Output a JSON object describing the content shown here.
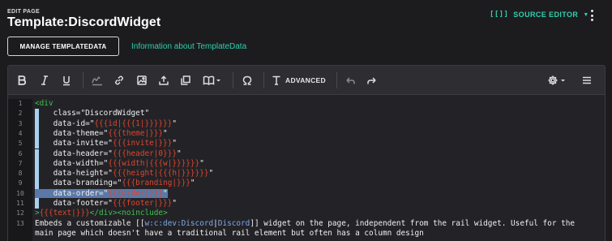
{
  "header": {
    "edit_label": "EDIT PAGE",
    "title": "Template:DiscordWidget",
    "source_editor_label": "SOURCE EDITOR",
    "source_editor_icon": "[[]]"
  },
  "actions": {
    "manage_button": "MANAGE TEMPLATEDATA",
    "info_link": "Information about TemplateData"
  },
  "toolbar": {
    "advanced_label": "ADVANCED",
    "buttons": [
      "bold-icon",
      "italic-icon",
      "underline-icon",
      "signature-icon",
      "link-icon",
      "image-icon",
      "upload-icon",
      "gallery-icon",
      "book-icon",
      "special-characters-icon",
      "text-format-icon",
      "undo-icon",
      "redo-icon",
      "settings-icon",
      "menu-icon"
    ]
  },
  "code": {
    "lines": [
      {
        "n": "1",
        "parts": [
          {
            "t": "<div",
            "c": "tag"
          }
        ]
      },
      {
        "n": "2",
        "parts": [
          {
            "t": "    class=\"DiscordWidget\"",
            "c": "attr"
          }
        ]
      },
      {
        "n": "3",
        "parts": [
          {
            "t": "    data-id=\"",
            "c": "attr"
          },
          {
            "t": "{{{id|{{{1|}}}}}}",
            "c": "tpl"
          },
          {
            "t": "\"",
            "c": "attr"
          }
        ]
      },
      {
        "n": "4",
        "parts": [
          {
            "t": "    data-theme=\"",
            "c": "attr"
          },
          {
            "t": "{{{theme|}}}",
            "c": "tpl"
          },
          {
            "t": "\"",
            "c": "attr"
          }
        ]
      },
      {
        "n": "5",
        "parts": [
          {
            "t": "    data-invite=\"",
            "c": "attr"
          },
          {
            "t": "{{{invite|}}}",
            "c": "tpl"
          },
          {
            "t": "\"",
            "c": "attr"
          }
        ]
      },
      {
        "n": "6",
        "parts": [
          {
            "t": "    data-header=\"",
            "c": "attr"
          },
          {
            "t": "{{{header|0}}}",
            "c": "tpl"
          },
          {
            "t": "\"",
            "c": "attr"
          }
        ]
      },
      {
        "n": "7",
        "parts": [
          {
            "t": "    data-width=\"",
            "c": "attr"
          },
          {
            "t": "{{{width|{{{w|}}}}}}",
            "c": "tpl"
          },
          {
            "t": "\"",
            "c": "attr"
          }
        ]
      },
      {
        "n": "8",
        "parts": [
          {
            "t": "    data-height=\"",
            "c": "attr"
          },
          {
            "t": "{{{height|{{{h|}}}}}}",
            "c": "tpl"
          },
          {
            "t": "\"",
            "c": "attr"
          }
        ]
      },
      {
        "n": "9",
        "parts": [
          {
            "t": "    data-branding=\"",
            "c": "attr"
          },
          {
            "t": "{{{branding|}}}",
            "c": "tpl"
          },
          {
            "t": "\"",
            "c": "attr"
          }
        ]
      },
      {
        "n": "10",
        "parts": [
          {
            "t": "    data-order=\"",
            "c": "attr"
          },
          {
            "t": "{{{order|}}}",
            "c": "tpl"
          },
          {
            "t": "\"",
            "c": "attr"
          }
        ]
      },
      {
        "n": "11",
        "parts": [
          {
            "t": "    data-footer=\"",
            "c": "attr"
          },
          {
            "t": "{{{footer|}}}",
            "c": "tpl"
          },
          {
            "t": "\"",
            "c": "attr"
          }
        ]
      },
      {
        "n": "12",
        "parts": [
          {
            "t": ">",
            "c": "tag"
          },
          {
            "t": "{{{text|}}}",
            "c": "tpl"
          },
          {
            "t": "</div>",
            "c": "tag"
          },
          {
            "t": "<noinclude>",
            "c": "tag"
          }
        ]
      },
      {
        "n": "13",
        "parts": [
          {
            "t": "Embeds a customizable [[",
            "c": "attr"
          },
          {
            "t": "w:c:dev:Discord",
            "c": "link"
          },
          {
            "t": "|",
            "c": "attr"
          },
          {
            "t": "Discord",
            "c": "link"
          },
          {
            "t": "]] widget on the page, independent from the rail widget. Useful for the",
            "c": "attr"
          }
        ]
      },
      {
        "n": "",
        "parts": [
          {
            "t": "main page which doesn't have a traditional rail element but often has a column design",
            "c": "attr"
          }
        ]
      }
    ]
  }
}
